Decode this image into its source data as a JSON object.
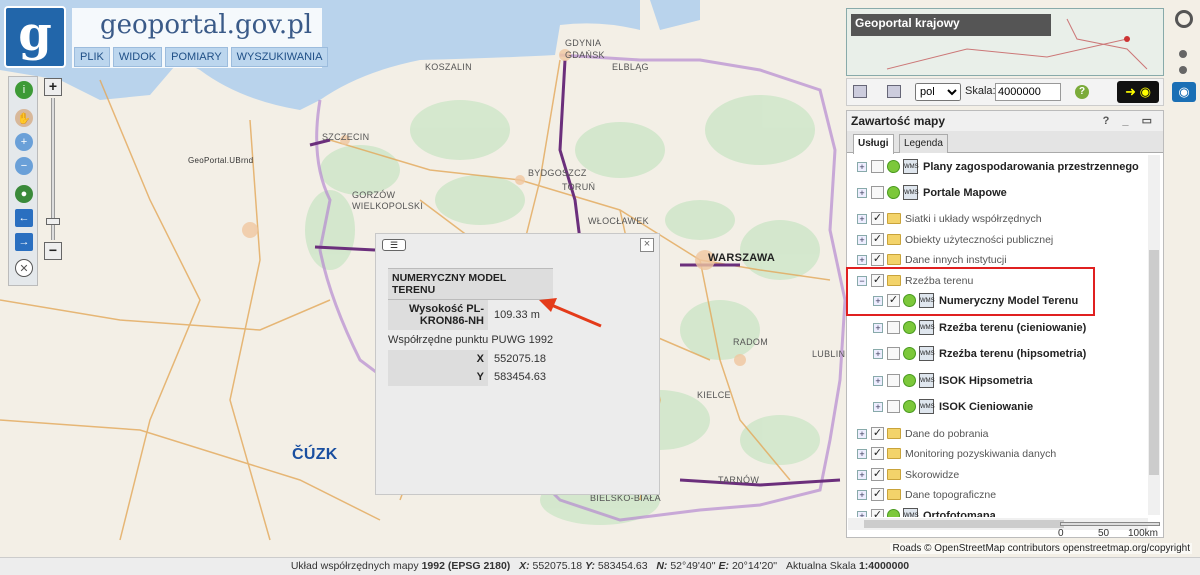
{
  "header": {
    "site_name": "geoportal.gov.pl",
    "menu": [
      "PLIK",
      "WIDOK",
      "POMIARY",
      "WYSZUKIWANIA"
    ]
  },
  "map": {
    "cities": [
      "GDYNIA",
      "GDAŃSK",
      "KOSZALIN",
      "ELBLĄG",
      "SZCZECIN",
      "BYDGOSZCZ",
      "TORUŃ",
      "GORZÓW WIELKOPOLSKI",
      "WŁOCŁAWEK",
      "WARSZAWA",
      "RADOM",
      "LUBLIN",
      "KIELCE",
      "BIELSKO-BIAŁA",
      "TARNÓW"
    ],
    "watermark_logo": "GeoPortal.UBrnd",
    "cuzk_logo": "ČÚZK",
    "scale_labels": [
      "0",
      "50",
      "100km"
    ],
    "attribution": "Roads © OpenStreetMap contributors openstreetmap.org/copyright"
  },
  "popup": {
    "title": "NUMERYCZNY MODEL TERENU",
    "height_label": "Wysokość PL-KRON86-NH",
    "height_value": "109.33 m",
    "coords_caption": "Współrzędne punktu PUWG 1992",
    "x_label": "X",
    "x_value": "552075.18",
    "y_label": "Y",
    "y_value": "583454.63"
  },
  "right_panel": {
    "minimap_label": "Geoportal krajowy",
    "language": "pol",
    "scale_label": "Skala:",
    "scale_value": "4000000",
    "content_title": "Zawartość mapy",
    "tabs": [
      "Usługi",
      "Legenda"
    ],
    "layers": [
      {
        "label": "Plany zagospodarowania przestrzennego",
        "bold": true,
        "checked": false,
        "kind": "service"
      },
      {
        "label": "Portale Mapowe",
        "bold": true,
        "checked": false,
        "kind": "service"
      },
      {
        "label": "Siatki i układy współrzędnych",
        "bold": false,
        "checked": true,
        "kind": "folder"
      },
      {
        "label": "Obiekty użyteczności publicznej",
        "bold": false,
        "checked": true,
        "kind": "folder"
      },
      {
        "label": "Dane innych instytucji",
        "bold": false,
        "checked": true,
        "kind": "folder"
      },
      {
        "label": "Rzeźba terenu",
        "bold": false,
        "checked": true,
        "kind": "folder"
      },
      {
        "label": "Numeryczny Model Terenu",
        "bold": true,
        "checked": true,
        "kind": "service"
      },
      {
        "label": "Rzeźba terenu (cieniowanie)",
        "bold": true,
        "checked": false,
        "kind": "service"
      },
      {
        "label": "Rzeźba terenu (hipsometria)",
        "bold": true,
        "checked": false,
        "kind": "service"
      },
      {
        "label": "ISOK Hipsometria",
        "bold": true,
        "checked": false,
        "kind": "service"
      },
      {
        "label": "ISOK Cieniowanie",
        "bold": true,
        "checked": false,
        "kind": "service"
      },
      {
        "label": "Dane do pobrania",
        "bold": false,
        "checked": true,
        "kind": "folder"
      },
      {
        "label": "Monitoring pozyskiwania danych",
        "bold": false,
        "checked": true,
        "kind": "folder"
      },
      {
        "label": "Skorowidze",
        "bold": false,
        "checked": true,
        "kind": "folder"
      },
      {
        "label": "Dane topograficzne",
        "bold": false,
        "checked": true,
        "kind": "folder"
      },
      {
        "label": "Ortofotomapa",
        "bold": true,
        "checked": true,
        "kind": "service"
      }
    ]
  },
  "statusbar": {
    "coord_system_label": "Układ współrzędnych mapy",
    "coord_system_value": "1992 (EPSG 2180)",
    "x_label": "X:",
    "x_value": "552075.18",
    "y_label": "Y:",
    "y_value": "583454.63",
    "n_label": "N:",
    "n_value": "52°49'40''",
    "e_label": "E:",
    "e_value": "20°14'20''",
    "scale_label": "Aktualna Skala",
    "scale_value": "1:4000000"
  }
}
